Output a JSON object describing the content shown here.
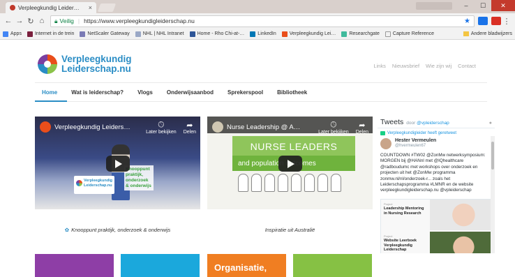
{
  "browser": {
    "tab_title": "Verpleegkundig Leider…",
    "secure_label": "Veilig",
    "url": "https://www.verpleegkundigleiderschap.nu",
    "bookmarks": [
      {
        "label": "Apps",
        "color": "#4285f4"
      },
      {
        "label": "Internet in de trein",
        "color": "#7a1f3d"
      },
      {
        "label": "NetScaler Gateway",
        "color": "#7b7bb5"
      },
      {
        "label": "NHL | NHL Intranet",
        "color": "#9aa8c6"
      },
      {
        "label": "Home - Rho Chi-at-…",
        "color": "#2e5597"
      },
      {
        "label": "LinkedIn",
        "color": "#0077b5"
      },
      {
        "label": "Verpleegkundig Lei…",
        "color": "#e94e1b"
      },
      {
        "label": "Researchgate",
        "color": "#40ba9c"
      },
      {
        "label": "Capture Reference",
        "color": "#ffffff"
      }
    ],
    "other_bookmarks": "Andere bladwijzers"
  },
  "site": {
    "logo_line1": "Verpleegkundig",
    "logo_line2": "Leiderschap.nu",
    "utility_links": [
      "Links",
      "Nieuwsbrief",
      "Wie zijn wij",
      "Contact"
    ],
    "nav": [
      "Home",
      "Wat is leiderschap?",
      "Vlogs",
      "Onderwijsaanbod",
      "Sprekerspool",
      "Bibliotheek"
    ],
    "videos": [
      {
        "title": "Verpleegkundig Leiders…",
        "later": "Later bekijken",
        "share": "Delen",
        "overlay_logo1": "Verpleegkundig",
        "overlay_logo2": "Leiderschap.nu",
        "overlay_text": "Knooppunt praktijk, onderzoek & onderwijs",
        "caption": "Knooppunt praktijk, onderzoek & onderwijs"
      },
      {
        "title": "Nurse Leadership @ A…",
        "later": "Later bekijken",
        "share": "Delen",
        "banner1": "NURSE LEADERS",
        "banner2": "and population outcomes",
        "caption": "Inspiratie uit Australië"
      }
    ],
    "tiles": [
      {
        "label": "",
        "color": "#8e3ea6"
      },
      {
        "label": "",
        "color": "#1ba8dc"
      },
      {
        "label": "Organisatie,",
        "color": "#f07e22"
      },
      {
        "label": "",
        "color": "#86c144"
      }
    ]
  },
  "twitter": {
    "heading": "Tweets",
    "by_prefix": "door",
    "by_handle": "@vpleiderschap",
    "retweet_text": "Verpleegkundigleider heeft geretweet",
    "user_name": "Hester Vermeulen",
    "user_handle": "@hvermeulen67",
    "body": "COUNTDOWN #TW02 @ZonMw netwerksymposium: MORGEN bij @HANnl met @IQhealthcare @radboudumc met workshops over onderzoek en projecten uit het @ZonMw programma zonmw.nl/nl/onderzoek-r... zoals het Leiderschapsprogramma #LMNR en de website verpleegkundigleiderschap.nu @vpleiderschap",
    "card1_small": "Project",
    "card1_text": "Leadership Mentoring in Nursing Research",
    "card2_small": "Project",
    "card2_text": "Website Leerboek Verpleegkundig Leiderschap"
  }
}
